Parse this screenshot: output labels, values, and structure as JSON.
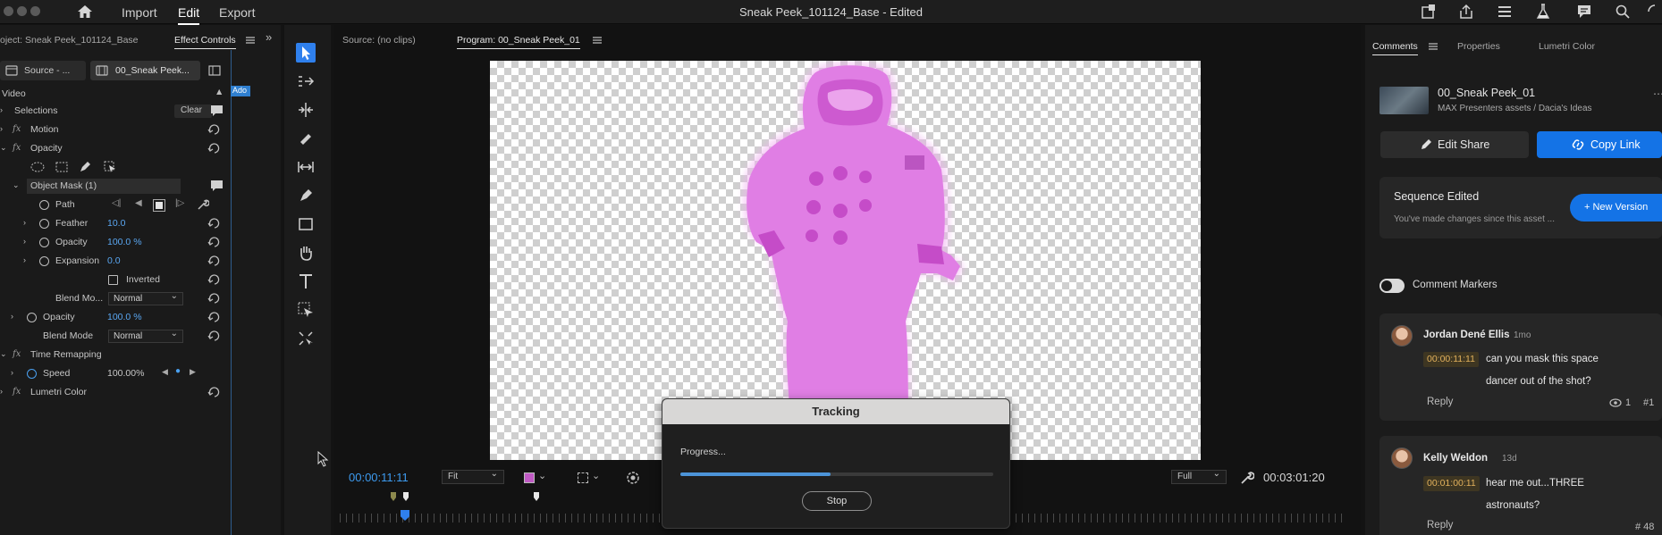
{
  "titlebar": {
    "menu": [
      "Import",
      "Edit",
      "Export"
    ],
    "document_title": "Sneak Peek_101124_Base - Edited"
  },
  "effect_controls": {
    "source_label": "oject: Sneak Peek_101124_Base",
    "tab_label": "Effect Controls",
    "source_dropdown": "Source - ...",
    "sequence_dropdown": "00_Sneak Peek...",
    "clip_mini_label": "Ado",
    "video_header": "Video",
    "selections": "Selections",
    "clear_label": "Clear",
    "motion": "Motion",
    "opacity": "Opacity",
    "object_mask": "Object Mask (1)",
    "path": "Path",
    "feather_label": "Feather",
    "feather_value": "10.0",
    "mask_opacity_label": "Opacity",
    "mask_opacity_value": "100.0 %",
    "expansion_label": "Expansion",
    "expansion_value": "0.0",
    "inverted_label": "Inverted",
    "mask_blend_label": "Blend Mo...",
    "mask_blend_value": "Normal",
    "opacity2_label": "Opacity",
    "opacity2_value": "100.0 %",
    "blend_label": "Blend Mode",
    "blend_value": "Normal",
    "time_remapping": "Time Remapping",
    "speed_label": "Speed",
    "speed_value": "100.00%",
    "lumetri": "Lumetri Color"
  },
  "monitor": {
    "source_tab": "Source: (no clips)",
    "program_tab": "Program: 00_Sneak Peek_01",
    "current_timecode": "00:00:11:11",
    "zoom": "Fit",
    "resolution": "Full",
    "duration": "00:03:01:20",
    "playhead_color": "#2f80ed"
  },
  "tracking": {
    "title": "Tracking",
    "progress_label": "Progress...",
    "progress": 0.48,
    "stop_label": "Stop"
  },
  "right_panel": {
    "tabs": [
      "Comments",
      "Properties",
      "Lumetri Color"
    ],
    "asset_name": "00_Sneak Peek_01",
    "asset_path": "MAX Presenters assets / Dacia's Ideas",
    "edit_share": "Edit Share",
    "copy_link": "Copy Link",
    "sequence_edited_title": "Sequence Edited",
    "sequence_edited_desc": "You've made changes since this asset ...",
    "new_version": "+ New Version",
    "comment_markers": "Comment Markers",
    "comments": [
      {
        "author": "Jordan Dené Ellis",
        "age": "1mo",
        "timecode": "00:00:11:11",
        "line1": "can you mask this space",
        "line2": "dancer out of the shot?",
        "reply": "Reply",
        "views": "1",
        "index": "#1"
      },
      {
        "author": "Kelly Weldon",
        "age": "13d",
        "timecode": "00:01:00:11",
        "line1": "hear me out...THREE",
        "line2": "astronauts?",
        "reply": "Reply",
        "index": "# 48"
      }
    ]
  },
  "colors": {
    "accent_blue": "#1473e6",
    "mask_magenta": "#e87de8",
    "timecode_blue": "#3d9bf0",
    "comment_timecode": "#e2b15c"
  }
}
